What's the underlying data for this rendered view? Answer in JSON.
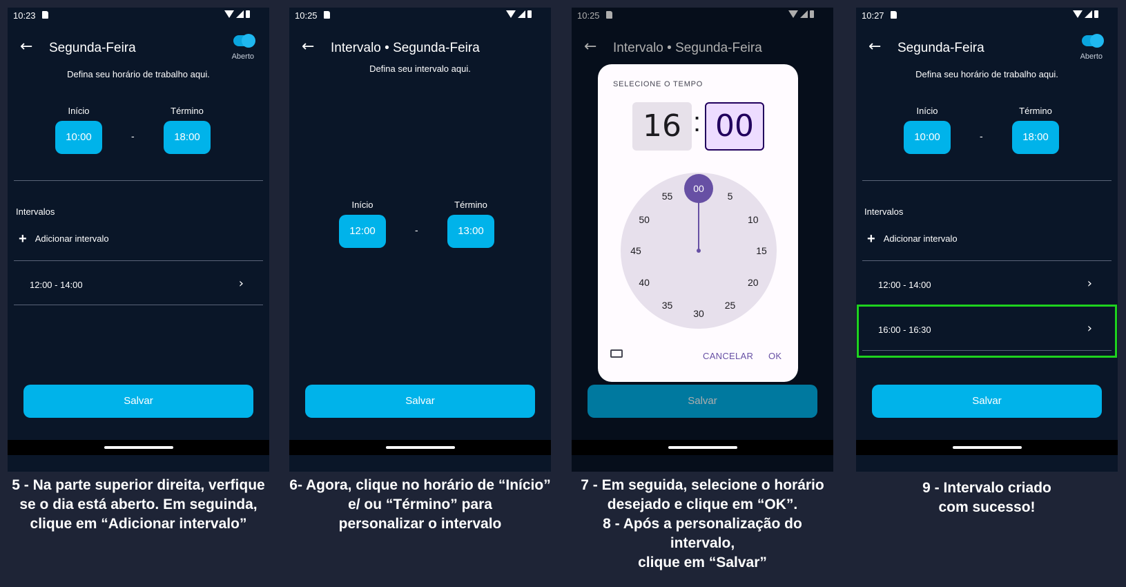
{
  "panels": [
    {
      "status_time": "10:23",
      "title": "Segunda-Feira",
      "toggle_label": "Aberto",
      "subtitle": "Defina seu horário de trabalho aqui.",
      "start_label": "Início",
      "end_label": "Término",
      "start_value": "10:00",
      "end_value": "18:00",
      "dash": "-",
      "intervals_label": "Intervalos",
      "add_interval": "Adicionar intervalo",
      "intervals": [
        "12:00 - 14:00"
      ],
      "save": "Salvar",
      "caption": [
        "5 - Na parte superior direita, verfique",
        "se o dia está aberto. Em seguinda,",
        "clique em “Adicionar intervalo”"
      ]
    },
    {
      "status_time": "10:25",
      "title": "Intervalo • Segunda-Feira",
      "subtitle": "Defina seu intervalo aqui.",
      "start_label": "Início",
      "end_label": "Término",
      "start_value": "12:00",
      "end_value": "13:00",
      "dash": "-",
      "save": "Salvar",
      "caption": [
        "6- Agora, clique no horário de “Início”",
        "e/ ou “Término” para",
        "personalizar o intervalo"
      ]
    },
    {
      "status_time": "10:25",
      "title": "Intervalo • Segunda-Feira",
      "save": "Salvar",
      "dialog": {
        "title": "SELECIONE O TEMPO",
        "hour": "16",
        "separator": ":",
        "minute": "00",
        "selected_minute": "00",
        "clock_numbers": [
          "5",
          "10",
          "15",
          "20",
          "25",
          "30",
          "35",
          "40",
          "45",
          "50",
          "55"
        ],
        "cancel": "CANCELAR",
        "ok": "OK",
        "keyboard_icon": "keyboard-icon"
      },
      "caption": [
        "7 - Em seguida, selecione o horário",
        "desejado e clique em “OK”.",
        "8 - Após a personalização do intervalo,",
        "clique em “Salvar”"
      ]
    },
    {
      "status_time": "10:27",
      "title": "Segunda-Feira",
      "toggle_label": "Aberto",
      "subtitle": "Defina seu horário de trabalho aqui.",
      "start_label": "Início",
      "end_label": "Término",
      "start_value": "10:00",
      "end_value": "18:00",
      "dash": "-",
      "intervals_label": "Intervalos",
      "add_interval": "Adicionar intervalo",
      "intervals": [
        "12:00 - 14:00",
        "16:00 - 16:30"
      ],
      "save": "Salvar",
      "caption": [
        "9 - Intervalo criado",
        "com sucesso!"
      ]
    }
  ],
  "colors": {
    "background": "#1e2436",
    "screen": "#0a1628",
    "accent": "#00b3ea",
    "highlight": "#1ed21e",
    "dialog_primary": "#6750a4"
  }
}
